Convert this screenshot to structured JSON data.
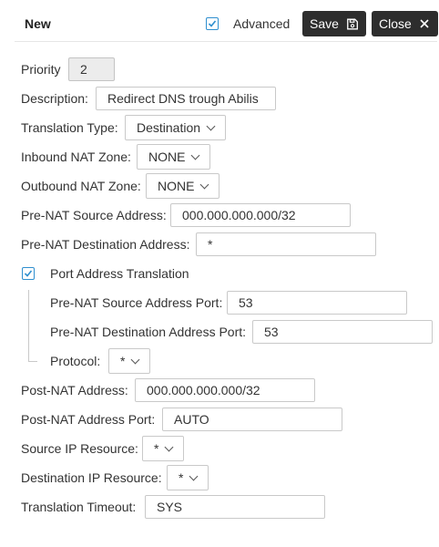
{
  "header": {
    "title": "New",
    "advanced_label": "Advanced",
    "save_label": "Save",
    "close_label": "Close"
  },
  "form": {
    "priority": {
      "label": "Priority",
      "value": "2"
    },
    "description": {
      "label": "Description:",
      "value": "Redirect DNS trough Abilis"
    },
    "translation_type": {
      "label": "Translation Type:",
      "value": "Destination"
    },
    "inbound_nat_zone": {
      "label": "Inbound NAT Zone:",
      "value": "NONE"
    },
    "outbound_nat_zone": {
      "label": "Outbound NAT Zone:",
      "value": "NONE"
    },
    "pre_nat_source_address": {
      "label": "Pre-NAT Source Address:",
      "value": "000.000.000.000/32"
    },
    "pre_nat_destination_address": {
      "label": "Pre-NAT Destination Address:",
      "value": "*"
    },
    "port_address_translation": {
      "label": "Port Address Translation",
      "checked": true
    },
    "pre_nat_source_address_port": {
      "label": "Pre-NAT Source Address Port:",
      "value": "53"
    },
    "pre_nat_destination_address_port": {
      "label": "Pre-NAT Destination Address Port:",
      "value": "53"
    },
    "protocol": {
      "label": "Protocol:",
      "value": "*"
    },
    "post_nat_address": {
      "label": "Post-NAT Address:",
      "value": "000.000.000.000/32"
    },
    "post_nat_address_port": {
      "label": "Post-NAT Address Port:",
      "value": "AUTO"
    },
    "source_ip_resource": {
      "label": "Source IP Resource:",
      "value": "*"
    },
    "destination_ip_resource": {
      "label": "Destination IP Resource:",
      "value": "*"
    },
    "translation_timeout": {
      "label": "Translation Timeout:",
      "value": "SYS"
    }
  },
  "colors": {
    "accent": "#2f8fcf",
    "button_bg": "#2d2d2d"
  }
}
